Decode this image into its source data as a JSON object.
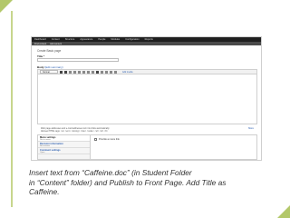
{
  "slide": {
    "caption_lines": [
      "Insert text from “Caffeine.doc” (in Student Folder",
      "in “Content” folder) and Publish to Front Page. Add Title as",
      "Caffeine."
    ],
    "accent_color": "#b3c86a"
  },
  "screenshot": {
    "admin_menu": [
      "Dashboard",
      "Content",
      "Structure",
      "Appearance",
      "People",
      "Modules",
      "Configuration",
      "Reports"
    ],
    "shortcut_menu": [
      "Find content",
      "Add content"
    ],
    "page_title": "Create Basic page",
    "title_label": "Title *",
    "title_value": "",
    "body_label": "Body",
    "body_hide": "(Edit summary)",
    "format_select": "Normal",
    "toolbar_link": "Add media",
    "format_help": [
      "Web page addresses and e-mail addresses turn into links automatically.",
      "Allowed HTML tags: <a> <em> <strong> <cite> <code> <ul> <ol> <li>"
    ],
    "format_help_link": "More",
    "vertical_tabs": [
      {
        "title": "Menu settings",
        "summary": "Not in menu"
      },
      {
        "title": "Revision information",
        "summary": "No revision"
      },
      {
        "title": "Comment settings",
        "summary": "Open"
      }
    ],
    "menu_checkbox_label": "Provide a menu link"
  }
}
